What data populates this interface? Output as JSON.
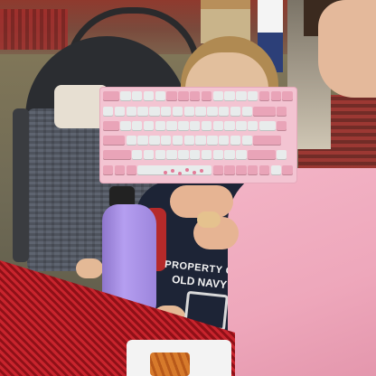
{
  "shirt": {
    "line1": "PROPERTY OF",
    "line2": "OLD NAVY"
  }
}
